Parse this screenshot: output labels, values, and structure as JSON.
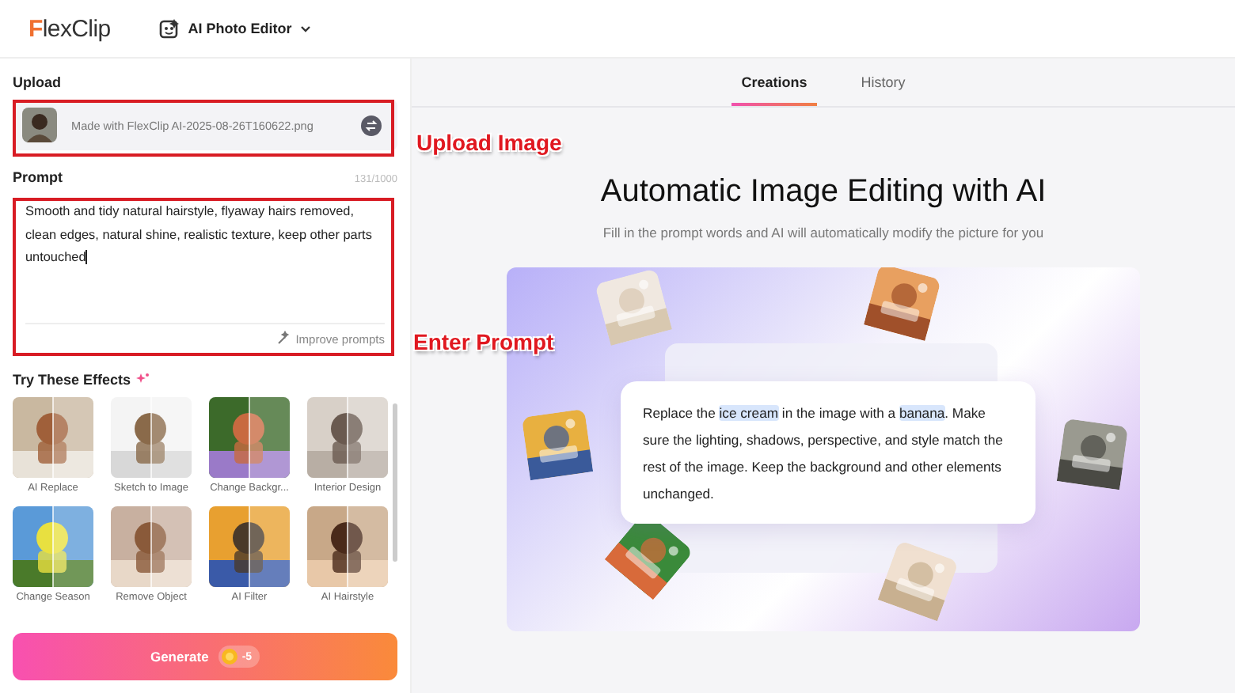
{
  "header": {
    "logo": "FlexClip",
    "tool_menu": "AI Photo Editor"
  },
  "upload": {
    "label": "Upload",
    "file_name": "Made with FlexClip AI-2025-08-26T160622.png"
  },
  "prompt": {
    "label": "Prompt",
    "counter": "131/1000",
    "value": "Smooth and tidy natural hairstyle, flyaway hairs removed, clean edges, natural shine, realistic texture, keep other parts untouched",
    "improve": "Improve prompts"
  },
  "annotations": [
    {
      "text": "Upload Image"
    },
    {
      "text": "Enter Prompt"
    }
  ],
  "effects": {
    "title": "Try These Effects",
    "items": [
      {
        "label": "AI Replace"
      },
      {
        "label": "Sketch to Image"
      },
      {
        "label": "Change Backgr..."
      },
      {
        "label": "Interior Design"
      },
      {
        "label": "Change Season"
      },
      {
        "label": "Remove Object"
      },
      {
        "label": "AI Filter"
      },
      {
        "label": "AI Hairstyle"
      }
    ]
  },
  "generate": {
    "label": "Generate",
    "cost": "-5"
  },
  "tabs": [
    {
      "label": "Creations",
      "selected": true
    },
    {
      "label": "History",
      "selected": false
    }
  ],
  "hero": {
    "title": "Automatic Image Editing with AI",
    "subtitle": "Fill in the prompt words and AI will automatically modify the picture for you",
    "example": [
      {
        "text": "Replace the ",
        "highlight": false
      },
      {
        "text": "ice cream",
        "highlight": true
      },
      {
        "text": " in the image with a ",
        "highlight": false
      },
      {
        "text": "banana",
        "highlight": true
      },
      {
        "text": ". Make sure the lighting, shadows, perspective, and style match the rest of the image. Keep the background and other elements unchanged.",
        "highlight": false
      }
    ]
  }
}
